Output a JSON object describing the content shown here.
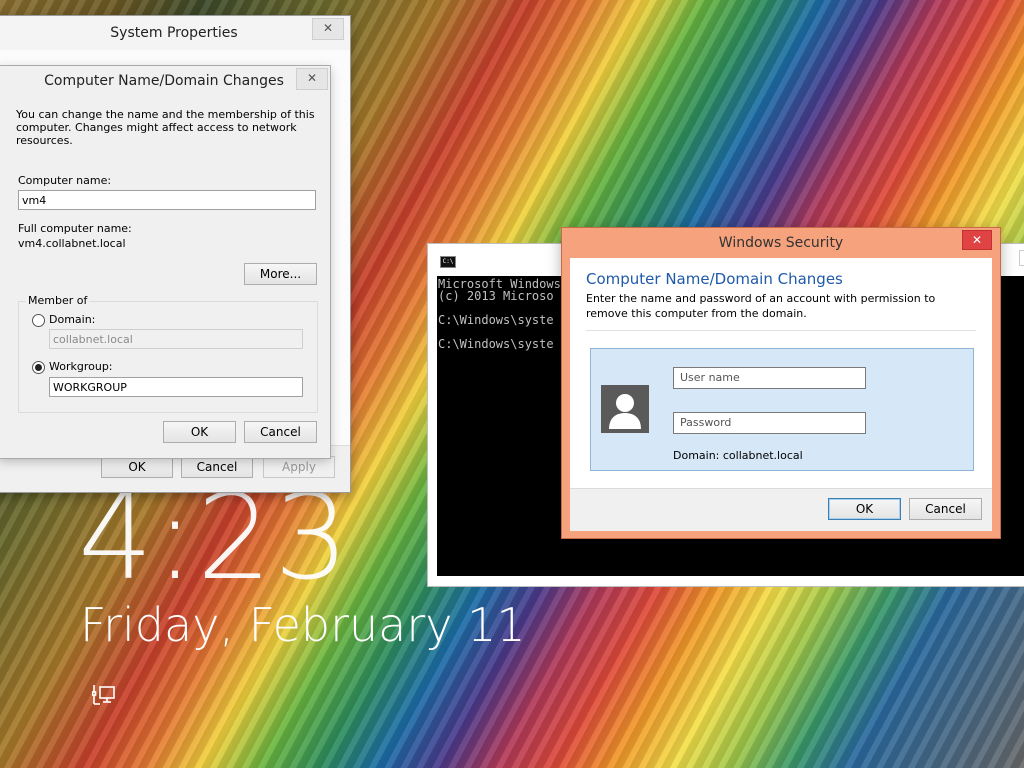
{
  "lock_screen": {
    "time": "4:23",
    "date": "Friday, February 11",
    "network_icon": "network-icon"
  },
  "system_properties": {
    "title": "System Properties",
    "close_label": "✕",
    "buttons": {
      "ok": "OK",
      "cancel": "Cancel",
      "apply": "Apply"
    }
  },
  "computer_name_dialog": {
    "title": "Computer Name/Domain Changes",
    "close_label": "✕",
    "description": "You can change the name and the membership of this computer. Changes might affect access to network resources.",
    "computer_name_label": "Computer name:",
    "computer_name_value": "vm4",
    "full_name_label": "Full computer name:",
    "full_name_value": "vm4.collabnet.local",
    "more_button": "More...",
    "member_of_label": "Member of",
    "domain_label": "Domain:",
    "domain_value": "collabnet.local",
    "workgroup_label": "Workgroup:",
    "workgroup_value": "WORKGROUP",
    "selected": "workgroup",
    "buttons": {
      "ok": "OK",
      "cancel": "Cancel"
    }
  },
  "cmd_window": {
    "icon_label": "C:\\",
    "lines": [
      "Microsoft Windows",
      "(c) 2013 Microso",
      "",
      "C:\\Windows\\syste",
      "",
      "C:\\Windows\\syste"
    ]
  },
  "windows_security": {
    "title": "Windows Security",
    "close_label": "✕",
    "heading": "Computer Name/Domain Changes",
    "message": "Enter the name and password of an account with permission to remove this computer from the domain.",
    "username_placeholder": "User name",
    "password_placeholder": "Password",
    "domain_text": "Domain: collabnet.local",
    "buttons": {
      "ok": "OK",
      "cancel": "Cancel"
    },
    "colors": {
      "frame": "#f6a27c",
      "close": "#e04343",
      "heading": "#1f5aa8",
      "tile": "#d6e8f8"
    }
  }
}
